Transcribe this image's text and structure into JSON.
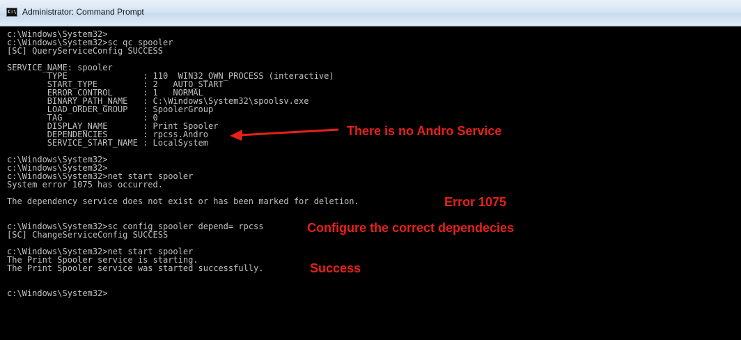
{
  "window": {
    "title": "Administrator: Command Prompt",
    "icon_label": "C:\\",
    "icon": "console-icon"
  },
  "console": {
    "lines": [
      "c:\\Windows\\System32>",
      "c:\\Windows\\System32>sc qc spooler",
      "[SC] QueryServiceConfig SUCCESS",
      "",
      "SERVICE_NAME: spooler",
      "        TYPE               : 110  WIN32_OWN_PROCESS (interactive)",
      "        START_TYPE         : 2   AUTO_START",
      "        ERROR_CONTROL      : 1   NORMAL",
      "        BINARY_PATH_NAME   : C:\\Windows\\System32\\spoolsv.exe",
      "        LOAD_ORDER_GROUP   : SpoolerGroup",
      "        TAG                : 0",
      "        DISPLAY_NAME       : Print Spooler",
      "        DEPENDENCIES       : rpcss.Andro",
      "        SERVICE_START_NAME : LocalSystem",
      "",
      "c:\\Windows\\System32>",
      "c:\\Windows\\System32>",
      "c:\\Windows\\System32>net start spooler",
      "System error 1075 has occurred.",
      "",
      "The dependency service does not exist or has been marked for deletion.",
      "",
      "",
      "c:\\Windows\\System32>sc config spooler depend= rpcss",
      "[SC] ChangeServiceConfig SUCCESS",
      "",
      "c:\\Windows\\System32>net start spooler",
      "The Print Spooler service is starting.",
      "The Print Spooler service was started successfully.",
      "",
      "",
      "c:\\Windows\\System32>"
    ]
  },
  "annotations": {
    "no_andro": "There is no Andro Service",
    "error_1075": "Error 1075",
    "configure": "Configure the correct dependecies",
    "success": "Success"
  },
  "colors": {
    "console_text": "#c0c0c0",
    "annotation": "#e8201a",
    "background": "#000000"
  }
}
